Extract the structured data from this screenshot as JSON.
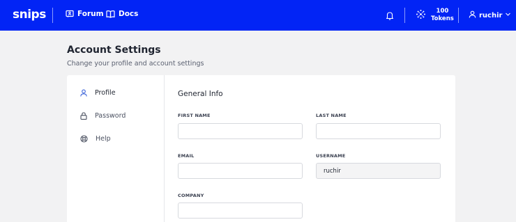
{
  "topbar": {
    "logo": "snips",
    "nav": [
      {
        "label": "Forum",
        "icon": "forum-icon"
      },
      {
        "label": "Docs",
        "icon": "book-icon"
      }
    ],
    "notifications_icon": "bell-icon",
    "tokens": {
      "count": "100",
      "label": "Tokens",
      "icon": "token-icon"
    },
    "user": {
      "name": "ruchir",
      "icon": "user-icon",
      "menu_icon": "chevron-down-icon"
    },
    "brand_color": "#0224f5"
  },
  "page": {
    "title": "Account Settings",
    "subtitle": "Change your profile and account settings"
  },
  "sidebar": {
    "items": [
      {
        "label": "Profile",
        "icon": "user-icon",
        "active": true
      },
      {
        "label": "Password",
        "icon": "lock-icon",
        "active": false
      },
      {
        "label": "Help",
        "icon": "lifebuoy-icon",
        "active": false
      }
    ]
  },
  "form": {
    "section_title": "General Info",
    "first_name": {
      "label": "FIRST NAME",
      "value": ""
    },
    "last_name": {
      "label": "LAST NAME",
      "value": ""
    },
    "email": {
      "label": "EMAIL",
      "value": ""
    },
    "username": {
      "label": "USERNAME",
      "value": "ruchir",
      "readonly": true
    },
    "company": {
      "label": "COMPANY",
      "value": ""
    }
  }
}
